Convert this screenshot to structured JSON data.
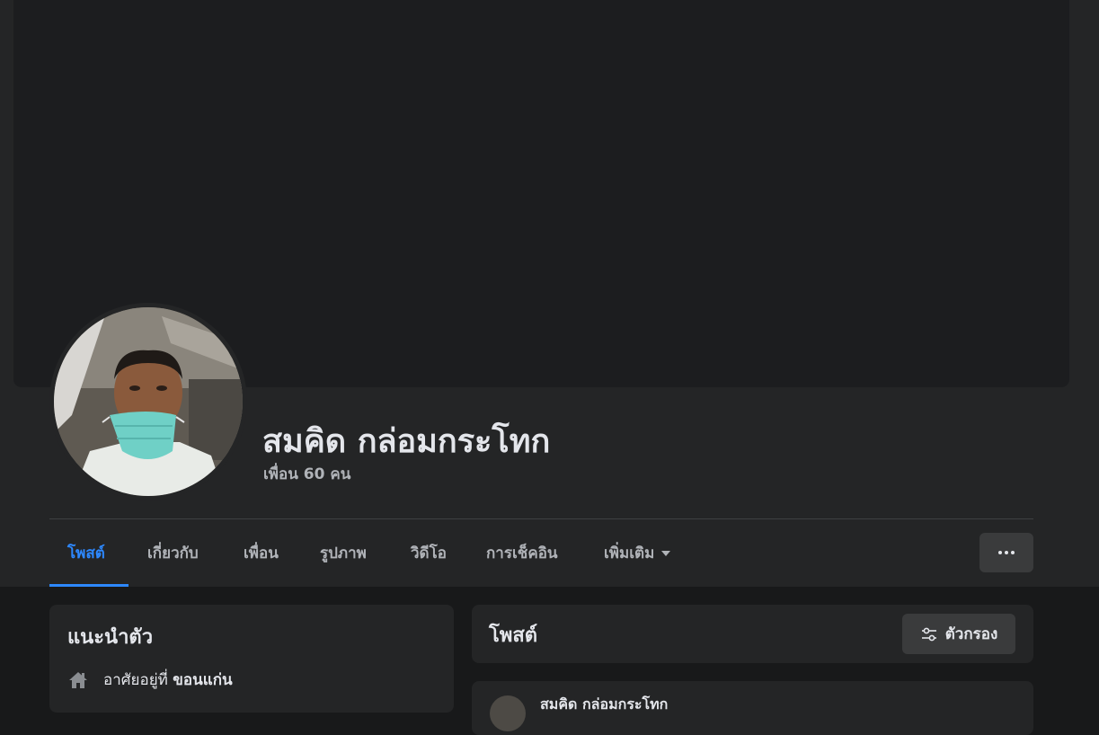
{
  "profile": {
    "name": "สมคิด กล่อมกระโทก",
    "friends": "เพื่อน 60 คน"
  },
  "tabs": [
    {
      "label": "โพสต์",
      "active": true
    },
    {
      "label": "เกี่ยวกับ",
      "active": false
    },
    {
      "label": "เพื่อน",
      "active": false
    },
    {
      "label": "รูปภาพ",
      "active": false
    },
    {
      "label": "วิดีโอ",
      "active": false
    },
    {
      "label": "การเช็คอิน",
      "active": false
    },
    {
      "label": "เพิ่มเติม",
      "active": false
    }
  ],
  "intro": {
    "title": "แนะนำตัว",
    "lives_prefix": "อาศัยอยู่ที่",
    "lives_city": "ขอนแก่น",
    "icon": "home-icon"
  },
  "posts": {
    "title": "โพสต์",
    "filter_label": "ตัวกรอง",
    "filter_icon": "filter-sliders-icon"
  },
  "colors": {
    "accent": "#2d88ff",
    "page_bg": "#18191a",
    "card_bg": "#242526",
    "button_bg": "#3a3b3c",
    "text_primary": "#e4e6eb",
    "text_secondary": "#b0b3b8"
  }
}
